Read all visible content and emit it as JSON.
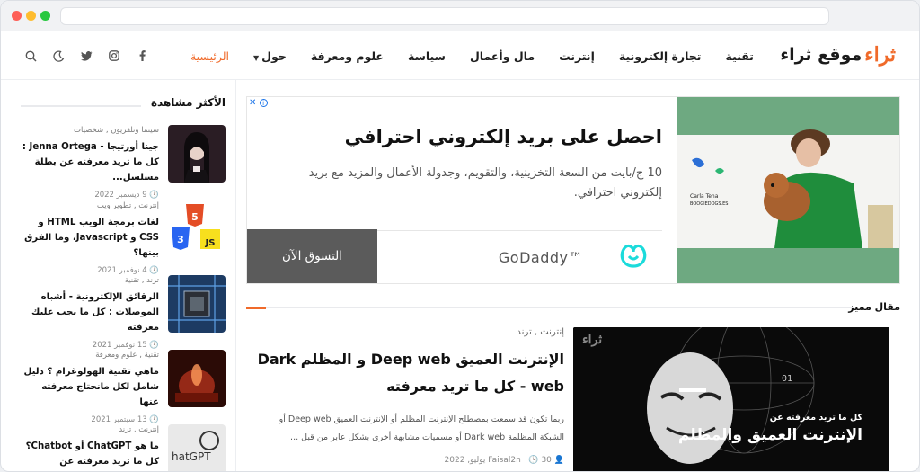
{
  "site": {
    "logo_mark": "ثراء",
    "logo_text": "موقع ثراء"
  },
  "nav": {
    "items": [
      {
        "label": "الرئيسية",
        "active": true
      },
      {
        "label": "حول",
        "dropdown": true
      },
      {
        "label": "علوم ومعرفة"
      },
      {
        "label": "سياسة"
      },
      {
        "label": "مال وأعمال"
      },
      {
        "label": "إنترنت"
      },
      {
        "label": "تجارة إلكترونية"
      },
      {
        "label": "تقنية"
      }
    ]
  },
  "header_icons": [
    "facebook-icon",
    "instagram-icon",
    "twitter-icon",
    "dark-mode-icon",
    "search-icon"
  ],
  "sidebar": {
    "title": "الأكثر مشاهدة",
    "items": [
      {
        "category": "سينما وتلفزيون , شخصيات",
        "title": "جينا أورتيجا - Jenna Ortega : كل ما تريد معرفته عن بطلة مسلسل...",
        "date": "9 ديسمبر 2022"
      },
      {
        "category": "إنترنت , تطوير ويب",
        "title": "لغات برمجة الويب HTML و CSS و Javascript، وما الفرق بينها؟",
        "date": "4 نوفمبر 2021"
      },
      {
        "category": "ترند , تقنية",
        "title": "الرقائق الإلكترونية - أشباه الموصلات : كل ما يجب عليك معرفته",
        "date": "15 نوفمبر 2021"
      },
      {
        "category": "تقنية , علوم ومعرفة",
        "title": "ماهي تقنية الهولوغرام ؟ دليل شامل لكل مانحتاج معرفته عنها",
        "date": "13 سبتمبر 2021"
      },
      {
        "category": "إنترنت , ترند",
        "title": "ما هو ChatGPT أو Chatbot؟ كل ما تريد معرفته عن ChatGPT",
        "date": ""
      }
    ]
  },
  "ad": {
    "headline": "احصل على بريد إلكتروني احترافي",
    "body": "10 ج/بايت من السعة التخزينية، والتقويم، وجدولة الأعمال والمزيد مع بريد إلكتروني احترافي.",
    "brand": "GoDaddy™",
    "cta": "التسوق الآن",
    "image_caption": "Carla Tena\nBOOGIEDOGS.ES"
  },
  "featured": {
    "section_title": "مقال مميز",
    "category": "إنترنت , ترند",
    "title": "الإنترنت العميق Deep web و المظلم Dark web - كل ما تريد معرفته",
    "excerpt": "ربما تكون قد سمعت بمصطلح الإنترنت المظلم أو الإنترنت العميق Deep web أو الشبكة المظلمة Dark web أو مسميات مشابهة أخرى بشكل عابر من قبل ...",
    "date": "30 يوليو, 2022",
    "author": "Faisal2n",
    "image_caption_small": "كل ما تريد معرفته عن",
    "image_caption_big": "الإنترنت العميق والمظلم",
    "image_logo": "ثراء"
  },
  "colors": {
    "accent": "#f06a2a",
    "ad_green": "#6ea981",
    "cta": "#5b5b5b"
  }
}
